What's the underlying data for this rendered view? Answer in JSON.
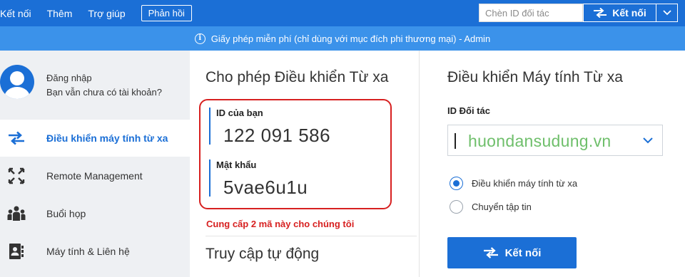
{
  "topbar": {
    "menu": [
      "Kết nối",
      "Thêm",
      "Trợ giúp"
    ],
    "feedback_label": "Phản hồi",
    "partner_id_placeholder": "Chèn ID đối tác",
    "connect_label": "Kết nối"
  },
  "license_bar": {
    "text": "Giấy phép miễn phí (chỉ dùng với mục đích phi thương mại) - Admin"
  },
  "sidebar": {
    "account": {
      "line1": "Đăng nhập",
      "line2": "Bạn vẫn chưa có tài khoản?"
    },
    "items": [
      {
        "label": "Điều khiển máy tính từ xa",
        "icon": "arrows-swap-icon",
        "active": true
      },
      {
        "label": "Remote Management",
        "icon": "expand-arrows-icon",
        "active": false
      },
      {
        "label": "Buổi họp",
        "icon": "meeting-people-icon",
        "active": false
      },
      {
        "label": "Máy tính & Liên hệ",
        "icon": "contacts-icon",
        "active": false
      }
    ]
  },
  "allow_remote": {
    "title": "Cho phép Điều khiển Từ xa",
    "id_label": "ID của bạn",
    "id_value": "122 091 586",
    "password_label": "Mật khẩu",
    "password_value": "5vae6u1u",
    "note": "Cung cấp 2 mã này cho chúng tôi",
    "unattended_title": "Truy cập tự động"
  },
  "control_remote": {
    "title": "Điều khiển Máy tính Từ xa",
    "partner_id_label": "ID Đối tác",
    "watermark": "huondansudung.vn",
    "radio_options": [
      {
        "label": "Điều khiển máy tính từ xa",
        "checked": true
      },
      {
        "label": "Chuyển tập tin",
        "checked": false
      }
    ],
    "connect_label": "Kết nối"
  },
  "colors": {
    "brand_blue": "#1b6fd6",
    "license_blue": "#3b92ea",
    "highlight_red": "#d72020",
    "watermark_green": "#6fbf6b"
  }
}
